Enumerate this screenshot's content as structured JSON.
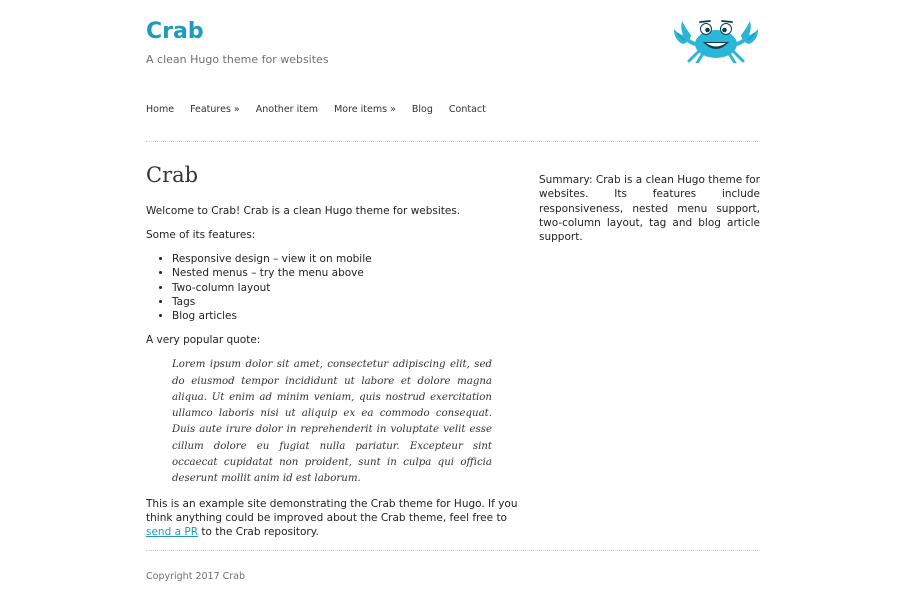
{
  "header": {
    "site_title": "Crab",
    "tagline": "A clean Hugo theme for websites",
    "logo_icon": "crab-icon",
    "brand_color": "#1d9bbd"
  },
  "nav": {
    "items": [
      {
        "label": "Home"
      },
      {
        "label": "Features »"
      },
      {
        "label": "Another item"
      },
      {
        "label": "More items »"
      },
      {
        "label": "Blog"
      },
      {
        "label": "Contact"
      }
    ]
  },
  "main": {
    "heading": "Crab",
    "intro": "Welcome to Crab! Crab is a clean Hugo theme for websites.",
    "features_lead": "Some of its features:",
    "features": [
      "Responsive design – view it on mobile",
      "Nested menus – try the menu above",
      "Two-column layout",
      "Tags",
      "Blog articles"
    ],
    "quote_lead": "A very popular quote:",
    "quote": "Lorem ipsum dolor sit amet, consectetur adipiscing elit, sed do eiusmod tempor incididunt ut labore et dolore magna aliqua. Ut enim ad minim veniam, quis nostrud exercitation ullamco laboris nisi ut aliquip ex ea commodo consequat. Duis aute irure dolor in reprehenderit in voluptate velit esse cillum dolore eu fugiat nulla pariatur. Excepteur sint occaecat cupidatat non proident, sunt in culpa qui officia deserunt mollit anim id est laborum.",
    "closing_before": "This is an example site demonstrating the Crab theme for Hugo. If you think anything could be improved about the Crab theme, feel free to ",
    "closing_link": "send a PR",
    "closing_after": " to the Crab repository."
  },
  "sidebar": {
    "summary": "Summary: Crab is a clean Hugo theme for websites. Its features include responsiveness, nested menu support, two-column layout, tag and blog article support."
  },
  "footer": {
    "copyright": "Copyright 2017 Crab"
  }
}
